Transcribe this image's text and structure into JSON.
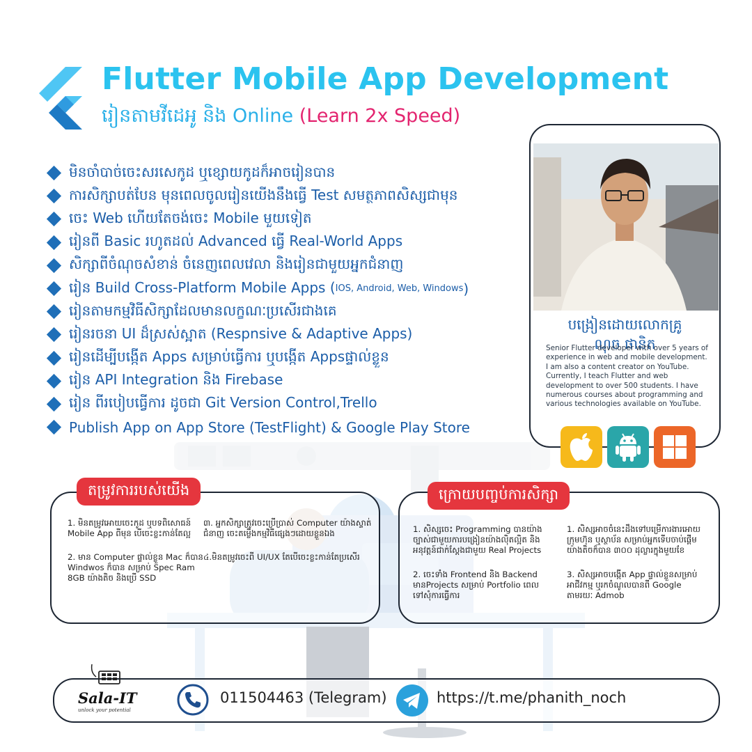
{
  "header": {
    "title": "Flutter Mobile App Development",
    "subtitle_main": "រៀនតាមវីដេអូ និង Online",
    "subtitle_accent": "(Learn 2x Speed)"
  },
  "features": [
    {
      "text": "មិនចាំបាច់ចេះសរសេកូដ ឬខ្សោយកូដក៏អាចរៀនបាន"
    },
    {
      "text": "ការសិក្សាបត់បែន មុនពេលចូលរៀនយើងនឹងធ្វើ Test សមត្ថភាពសិស្សជាមុន"
    },
    {
      "text": "ចេះ Web ហើយតែចង់ចេះ Mobile មួយទៀត"
    },
    {
      "text": "រៀនពី Basic រហូតដល់ Advanced ធ្វើ Real-World Apps"
    },
    {
      "text": "សិក្សាពីចំណុចសំខាន់ ចំនេញពេលវេលា និងរៀនជាមួយអ្នកជំនាញ"
    },
    {
      "text": "រៀន Build Cross-Platform Mobile Apps (",
      "small": "IOS, Android, Web, Windows",
      "tail": ")"
    },
    {
      "text": "រៀនតាមកម្មវិធីសិក្សាដែលមានលក្ខណៈប្រសើរជាងគេ"
    },
    {
      "text": "រៀនរចនា UI ដ៏ស្រស់ស្អាត (Respnsive & Adaptive Apps)"
    },
    {
      "text": "រៀនដើម្បីបង្កើត Apps សម្រាប់ធ្វើការ ឬបង្កើត Appsផ្ទាល់ខ្លួន"
    },
    {
      "text": "រៀន API Integration និង Firebase"
    },
    {
      "text": "រៀន ពីរបៀបធ្វើការ ដូចជា Git Version Control,Trello"
    },
    {
      "text": "Publish App on App Store (TestFlight) & Google Play Store"
    }
  ],
  "instructor": {
    "name_line1": "បង្រៀនដោយលោកគ្រូ",
    "name_line2": "ណុច ផានិត",
    "bio": "Senior Flutter developer with over 5 years of experience in web and mobile development. I am also a content creator on YouTube. Currently, I teach Flutter and web development to over 500 students. I have numerous courses about programming and various technologies available on YouTube."
  },
  "platform_icons": [
    "apple-icon",
    "android-icon",
    "windows-icon"
  ],
  "requirements": {
    "title": "តម្រូវការរបស់យើង",
    "item1": "1. មិនតម្រូវអោយចេះកូដ ឬបទពិសោធន៍ Mobile App ពីមុន បើចេះខ្លះកាន់តែល្អ",
    "item2": "2. មាន Computer ផ្ទាល់ខ្លួន Mac ក៏បាន Windwos ក៏បាន សម្រាប់ Spec Ram 8GB យ៉ាងតិច និងប្រើ SSD",
    "item3": "៣. អ្នកសិក្សាត្រូវចេះប្រើប្រាស់ Computer យ៉ាងស្ទាត់ជំនាញ ចេះតម្លើងកម្មវិធីផ្សេងៗដោយខ្លួនឯង",
    "item4": "៤.មិនតម្រូវចេះពី UI/UX តែបើចេះខ្លះកាន់តែប្រសើរ"
  },
  "outcomes": {
    "title": "ក្រោយបញ្ចប់ការសិក្សា",
    "item1": "1. សិស្សចេះ Programming បានយ៉ាងច្បាស់ជាមួយការបង្រៀនយ៉ាងល៉ិតល្អិត និងអនុវត្តន៍ជាក់ស្តែងជាមួយ Real Projects",
    "item2": "2. ចេះទាំង Frontend និង Backend មានProjects សម្រាប់ Portfolio ពេលទៅសុំការធ្វើការ",
    "item3": "1. សិស្សអាចចំនេះដឹងទៅបម្រើការងារអោយក្រុមហ៊ុន ឬស្ថាប័ន សម្រាប់អ្នកទើបចាប់ផ្តើមយ៉ាងតិចក៏បាន ៣០០ ដុល្លារក្នុងមួយខែ",
    "item4": "3. សិស្សអាចបង្កើត App ផ្ទាល់ខ្លួនសម្រាប់អាជីវកម្ម ឬរកចំណូលបានពី Google តាមរយៈ Admob"
  },
  "footer": {
    "brand_name": "Sala-IT",
    "brand_tagline": "unlock your potential",
    "phone": "011504463 (Telegram)",
    "telegram_url": "https://t.me/phanith_noch"
  },
  "colors": {
    "title": "#2bc3ef",
    "accent": "#e3246f",
    "list_text": "#1b5da8",
    "pill": "#e5363e",
    "apple_bg": "#f6b91b",
    "android_bg": "#2aa6a9",
    "windows_bg": "#ec6628"
  }
}
